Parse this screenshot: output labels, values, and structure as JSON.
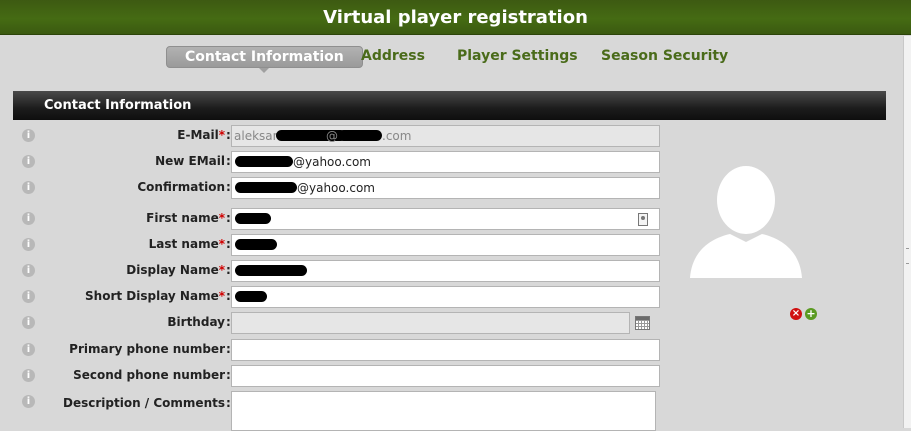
{
  "window": {
    "title": "Virtual player registration"
  },
  "tabs": [
    {
      "label": "Contact Information",
      "active": true
    },
    {
      "label": "Address",
      "active": false
    },
    {
      "label": "Player Settings",
      "active": false
    },
    {
      "label": "Season Security",
      "active": false
    }
  ],
  "section": {
    "title": "Contact Information"
  },
  "form": {
    "email": {
      "label": "E-Mail",
      "required": "*",
      "prefix": "aleksan",
      "suffix": ".com",
      "mid": "@"
    },
    "new_email": {
      "label": "New EMail",
      "suffix": "@yahoo.com"
    },
    "confirmation": {
      "label": "Confirmation",
      "suffix": "@yahoo.com"
    },
    "first_name": {
      "label": "First name",
      "required": "*"
    },
    "last_name": {
      "label": "Last name",
      "required": "*"
    },
    "display_name": {
      "label": "Display Name",
      "required": "*"
    },
    "short_display_name": {
      "label": "Short Display Name",
      "required": "*"
    },
    "birthday": {
      "label": "Birthday"
    },
    "primary_phone": {
      "label": "Primary phone number"
    },
    "second_phone": {
      "label": "Second phone number"
    },
    "description": {
      "label": "Description / Comments"
    }
  },
  "icons": {
    "info": "info-icon",
    "calendar": "calendar-icon",
    "contact_card": "contact-card-icon",
    "remove": "remove-icon",
    "add": "add-icon",
    "avatar": "avatar-placeholder"
  },
  "colors": {
    "title_bar": "#456b13",
    "tab_text": "#4a6b1a",
    "required": "#d00000",
    "remove": "#d01010",
    "add": "#5b9b22"
  }
}
